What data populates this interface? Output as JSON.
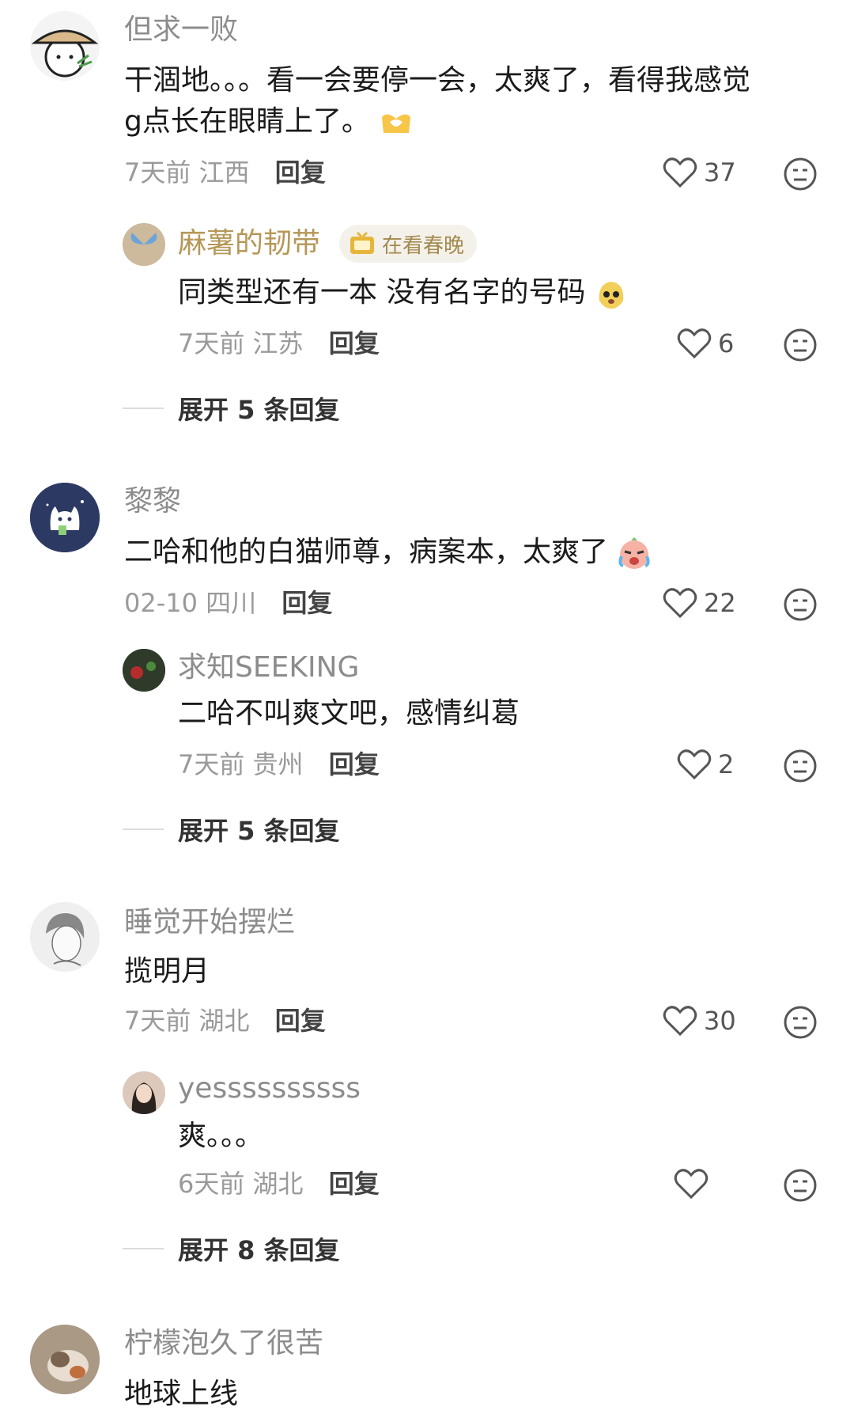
{
  "comments": [
    {
      "username": "但求一败",
      "text_line1": "干涸地。。。看一会要停一会，太爽了，看得我感觉",
      "text_line2": "g点长在眼睛上了。",
      "time": "7天前",
      "location": "江西",
      "reply_label": "回复",
      "likes": "37",
      "avatar_icon": "straw-hat-character-icon",
      "reply": {
        "username": "麻薯的韧带",
        "badge_label": "在看春晚",
        "text": "同类型还有一本 没有名字的号码",
        "time": "7天前",
        "location": "江苏",
        "reply_label": "回复",
        "likes": "6"
      },
      "expand_label": "展开 5 条回复"
    },
    {
      "username": "黎黎",
      "text_line1": "二哈和他的白猫师尊，病案本，太爽了",
      "time": "02-10",
      "location": "四川",
      "reply_label": "回复",
      "likes": "22",
      "reply": {
        "username": "求知SEEKING",
        "text": "二哈不叫爽文吧，感情纠葛",
        "time": "7天前",
        "location": "贵州",
        "reply_label": "回复",
        "likes": "2"
      },
      "expand_label": "展开 5 条回复"
    },
    {
      "username": "睡觉开始摆烂",
      "text_line1": "揽明月",
      "time": "7天前",
      "location": "湖北",
      "reply_label": "回复",
      "likes": "30",
      "reply": {
        "username": "yessssssssss",
        "text": "爽。。。",
        "time": "6天前",
        "location": "湖北",
        "reply_label": "回复",
        "likes": ""
      },
      "expand_label": "展开 8 条回复"
    },
    {
      "username": "柠檬泡久了很苦",
      "text_line1": "地球上线"
    }
  ],
  "colors": {
    "username": "#8c8c8c",
    "vip_username": "#b59757",
    "text": "#1b1b1b",
    "meta": "#9a9a9a"
  }
}
